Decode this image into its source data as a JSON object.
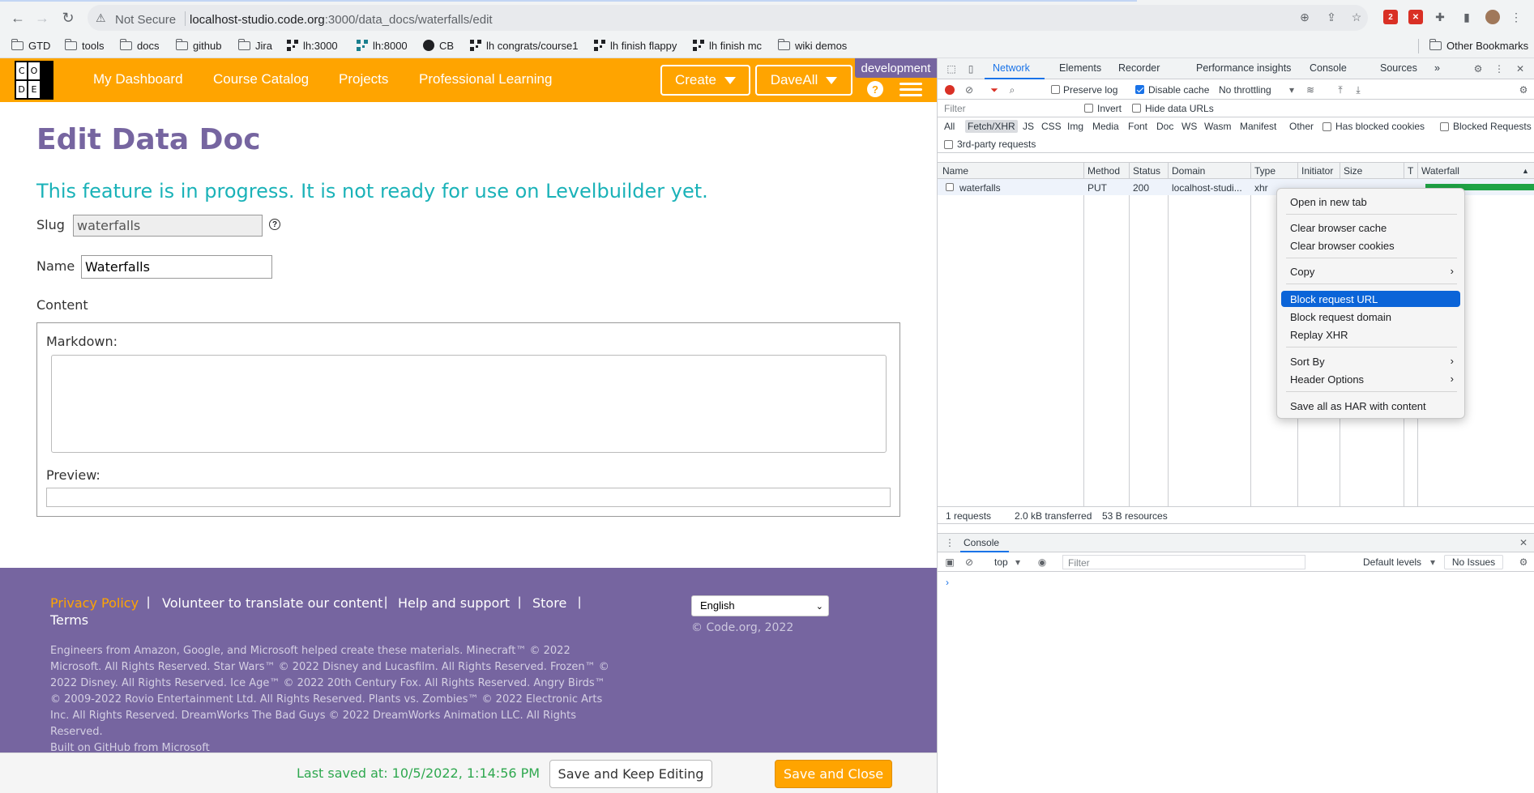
{
  "browser": {
    "security_label": "Not Secure",
    "url_host": "localhost-studio.code.org",
    "url_path": ":3000/data_docs/waterfalls/edit",
    "ext_badge": "2",
    "bookmarks": [
      {
        "label": "GTD",
        "icon": "folder-icon"
      },
      {
        "label": "tools",
        "icon": "folder-icon"
      },
      {
        "label": "docs",
        "icon": "folder-icon"
      },
      {
        "label": "github",
        "icon": "folder-icon"
      },
      {
        "label": "Jira",
        "icon": "folder-icon"
      },
      {
        "label": "lh:3000",
        "icon": "qr-icon"
      },
      {
        "label": "lh:8000",
        "icon": "qr-icon"
      },
      {
        "label": "CB",
        "icon": "github-icon"
      },
      {
        "label": "lh congrats/course1",
        "icon": "qr-icon"
      },
      {
        "label": "lh finish flappy",
        "icon": "qr-icon"
      },
      {
        "label": "lh finish mc",
        "icon": "qr-icon"
      },
      {
        "label": "wiki demos",
        "icon": "folder-icon"
      }
    ],
    "other_bookmarks": "Other Bookmarks"
  },
  "site": {
    "logo_letters": [
      "C",
      "O",
      "",
      "D",
      "E",
      ""
    ],
    "nav": [
      "My Dashboard",
      "Course Catalog",
      "Projects",
      "Professional Learning"
    ],
    "create_label": "Create",
    "user_label": "DaveAll",
    "env_badge": "development",
    "help_glyph": "?"
  },
  "form": {
    "title": "Edit Data Doc",
    "warning": "This feature is in progress. It is not ready for use on Levelbuilder yet.",
    "slug_label": "Slug",
    "slug_value": "waterfalls",
    "name_label": "Name",
    "name_value": "Waterfalls",
    "content_label": "Content",
    "markdown_label": "Markdown:",
    "markdown_value": "",
    "preview_label": "Preview:"
  },
  "footer": {
    "links": [
      "Privacy Policy",
      "Volunteer to translate our content",
      "Help and support",
      "Store",
      "Terms"
    ],
    "separator": "|",
    "language": "English",
    "copyright": "© Code.org, 2022",
    "legal": "Engineers from Amazon, Google, and Microsoft helped create these materials. Minecraft™ © 2022 Microsoft. All Rights Reserved. Star Wars™ © 2022 Disney and Lucasfilm. All Rights Reserved. Frozen™ © 2022 Disney. All Rights Reserved. Ice Age™ © 2022 20th Century Fox. All Rights Reserved. Angry Birds™ © 2009-2022 Rovio Entertainment Ltd. All Rights Reserved. Plants vs. Zombies™ © 2022 Electronic Arts Inc. All Rights Reserved. DreamWorks The Bad Guys © 2022 DreamWorks Animation LLC. All Rights Reserved.",
    "built_on": "Built on GitHub from Microsoft"
  },
  "savebar": {
    "last_saved": "Last saved at: 10/5/2022, 1:14:56 PM",
    "keep_label": "Save and Keep Editing",
    "close_label": "Save and Close"
  },
  "devtools": {
    "tabs": [
      "Network",
      "Elements",
      "Recorder",
      "Performance insights",
      "Console",
      "Sources"
    ],
    "more": "»",
    "preserve_log": "Preserve log",
    "disable_cache": "Disable cache",
    "throttling": "No throttling",
    "filter_placeholder": "Filter",
    "invert": "Invert",
    "hide_data_urls": "Hide data URLs",
    "types": [
      "All",
      "Fetch/XHR",
      "JS",
      "CSS",
      "Img",
      "Media",
      "Font",
      "Doc",
      "WS",
      "Wasm",
      "Manifest",
      "Other"
    ],
    "has_blocked_cookies": "Has blocked cookies",
    "blocked_requests": "Blocked Requests",
    "third_party": "3rd-party requests",
    "columns": [
      "Name",
      "Method",
      "Status",
      "Domain",
      "Type",
      "Initiator",
      "Size",
      "T",
      "Waterfall"
    ],
    "sort_glyph": "▲",
    "request": {
      "name": "waterfalls",
      "method": "PUT",
      "status": "200",
      "domain": "localhost-studi...",
      "type": "xhr"
    },
    "status_bar": [
      "1 requests",
      "2.0 kB transferred",
      "53 B resources"
    ],
    "drawer_tab": "Console",
    "console_context": "top",
    "console_filter": "Filter",
    "default_levels": "Default levels",
    "no_issues": "No Issues",
    "prompt": "›"
  },
  "context_menu": {
    "items": [
      "Open in new tab",
      "Clear browser cache",
      "Clear browser cookies",
      "Copy",
      "Block request URL",
      "Block request domain",
      "Replay XHR",
      "Sort By",
      "Header Options",
      "Save all as HAR with content"
    ],
    "submenu_arrow": "›"
  },
  "colors": {
    "brand_orange": "#ffa400",
    "brand_purple": "#7665a0",
    "warning_teal": "#1ab2b8",
    "highlight_blue": "#0b64d8",
    "waterfall_green": "#1ea446"
  }
}
